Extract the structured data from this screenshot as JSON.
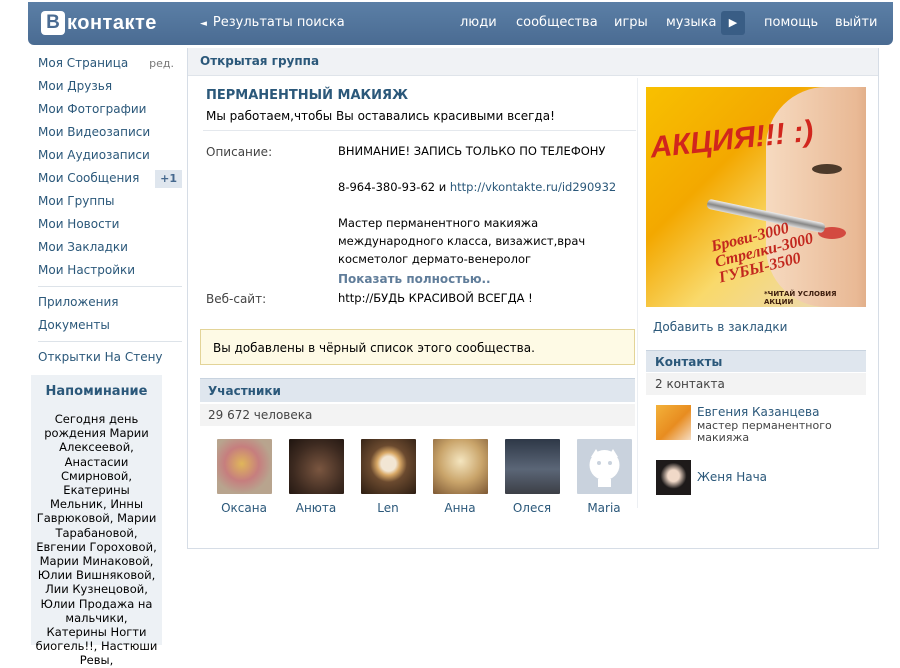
{
  "header": {
    "logo_letter": "В",
    "logo_text": "контакте",
    "back_arrow": "◄",
    "back_label": "Результаты поиска",
    "links": [
      "люди",
      "сообщества",
      "игры",
      "музыка",
      "помощь",
      "выйти"
    ],
    "more_icon": "▶"
  },
  "nav": {
    "items": [
      {
        "label": "Моя Страница",
        "extra": "ред."
      },
      {
        "label": "Мои Друзья"
      },
      {
        "label": "Мои Фотографии"
      },
      {
        "label": "Мои Видеозаписи"
      },
      {
        "label": "Мои Аудиозаписи"
      },
      {
        "label": "Мои Сообщения",
        "badge": "+1"
      },
      {
        "label": "Мои Группы"
      },
      {
        "label": "Мои Новости"
      },
      {
        "label": "Мои Закладки"
      },
      {
        "label": "Мои Настройки"
      }
    ],
    "apps": "Приложения",
    "docs": "Документы",
    "cards": "Открытки На Стену"
  },
  "reminder": {
    "title": "Напоминание",
    "text": "Сегодня день рождения Марии Алексеевой, Анастасии Смирновой, Екатерины Мельник, Инны Гаврюковой, Марии Тарабановой, Евгении Гороховой, Марии Минаковой, Юлии Вишняковой, Лии Кузнецовой, Юлии Продажа на мальчики, Катерины Ногти биогель!!, Настюши Ревы,"
  },
  "group": {
    "type": "Открытая группа",
    "title": "ПЕРМАНЕНТНЫЙ МАКИЯЖ",
    "status": "Мы работаем,чтобы Вы оставались красивыми всегда!",
    "description_label": "Описание:",
    "desc_line1": "ВНИМАНИЕ! ЗАПИСЬ ТОЛЬКО ПО ТЕЛЕФОНУ",
    "desc_phone": "8-964-380-93-62 и ",
    "desc_link": "http://vkontakte.ru/id290932",
    "desc_line3": "Мастер перманентного макияжа международного класса, визажист,врач косметолог дермато-венеролог",
    "show_more": "Показать полностью..",
    "website_label": "Веб-сайт:",
    "website_value": "http://БУДЬ КРАСИВОЙ ВСЕГДА !",
    "blacklist_notice": "Вы добавлены в чёрный список этого сообщества."
  },
  "members": {
    "title": "Участники",
    "count": "29 672 человека",
    "list": [
      {
        "name": "Оксана",
        "color": "#b8a48e"
      },
      {
        "name": "Анюта",
        "color": "#3d2a20"
      },
      {
        "name": "Len",
        "color": "#6b4a2f"
      },
      {
        "name": "Анна",
        "color": "#c9a46a"
      },
      {
        "name": "Олеся",
        "color": "#5b6677"
      },
      {
        "name": "Maria",
        "color": "#c9d2dd"
      }
    ]
  },
  "promo": {
    "headline": "АКЦИЯ!!! :)",
    "line1": "Брови-3000",
    "line2": "Стрелки-3000",
    "line3": "ГУБЫ-3500",
    "fine_print": "*ЧИТАЙ УСЛОВИЯ АКЦИИ"
  },
  "sidebar": {
    "bookmark": "Добавить в закладки",
    "contacts_title": "Контакты",
    "contacts_count": "2 контакта",
    "contacts": [
      {
        "name": "Евгения Казанцева",
        "role": "мастер перманентного макияжа"
      },
      {
        "name": "Женя Нача",
        "role": ""
      }
    ]
  }
}
